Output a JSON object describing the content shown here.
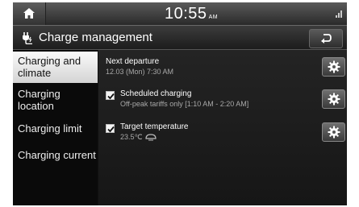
{
  "status_bar": {
    "time": "10:55",
    "ampm": "AM",
    "home_icon": "home-icon",
    "signal_icon": "signal-icon"
  },
  "header": {
    "title": "Charge management",
    "title_icon": "ev-plug-icon",
    "back_icon": "back-arrow-icon"
  },
  "sidebar": {
    "items": [
      {
        "label": "Charging and climate",
        "active": true
      },
      {
        "label": "Charging location",
        "active": false
      },
      {
        "label": "Charging limit",
        "active": false
      },
      {
        "label": "Charging current",
        "active": false
      }
    ]
  },
  "main": {
    "rows": [
      {
        "title": "Next departure",
        "subtitle": "12.03 (Mon) 7:30 AM",
        "checkbox": false,
        "settings_icon": "gear-icon"
      },
      {
        "title": "Scheduled charging",
        "subtitle": "Off-peak tariffs only [1:10 AM - 2:20 AM]",
        "checkbox": true,
        "checked": true,
        "settings_icon": "gear-icon"
      },
      {
        "title": "Target temperature",
        "subtitle": "23.5℃",
        "checkbox": true,
        "checked": true,
        "extra_icon": "climate-icon",
        "settings_icon": "gear-icon"
      }
    ]
  },
  "colors": {
    "active_tab_bg": "#e8e8e8",
    "panel_bg": "#1e1e1e",
    "text_primary": "#ffffff",
    "text_secondary": "#a8a8a8"
  }
}
